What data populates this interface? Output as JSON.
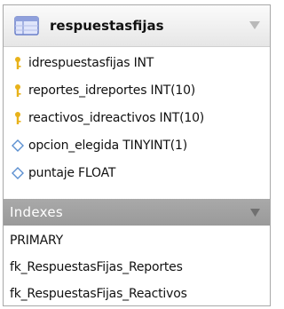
{
  "table": {
    "name": "respuestasfijas"
  },
  "columns": [
    {
      "label": "idrespuestasfijas INT",
      "icon": "key-icon"
    },
    {
      "label": "reportes_idreportes INT(10)",
      "icon": "key-icon"
    },
    {
      "label": "reactivos_idreactivos INT(10)",
      "icon": "key-icon"
    },
    {
      "label": "opcion_elegida TINYINT(1)",
      "icon": "diamond-icon"
    },
    {
      "label": "puntaje FLOAT",
      "icon": "diamond-icon"
    }
  ],
  "indexes": {
    "title": "Indexes",
    "items": [
      "PRIMARY",
      "fk_RespuestasFijas_Reportes",
      "fk_RespuestasFijas_Reactivos"
    ]
  },
  "colors": {
    "key": "#e8b21a",
    "diamond_border": "#5b8fd0",
    "indexes_header": "#a3a3a3",
    "table_icon": "#6a7fc9"
  }
}
